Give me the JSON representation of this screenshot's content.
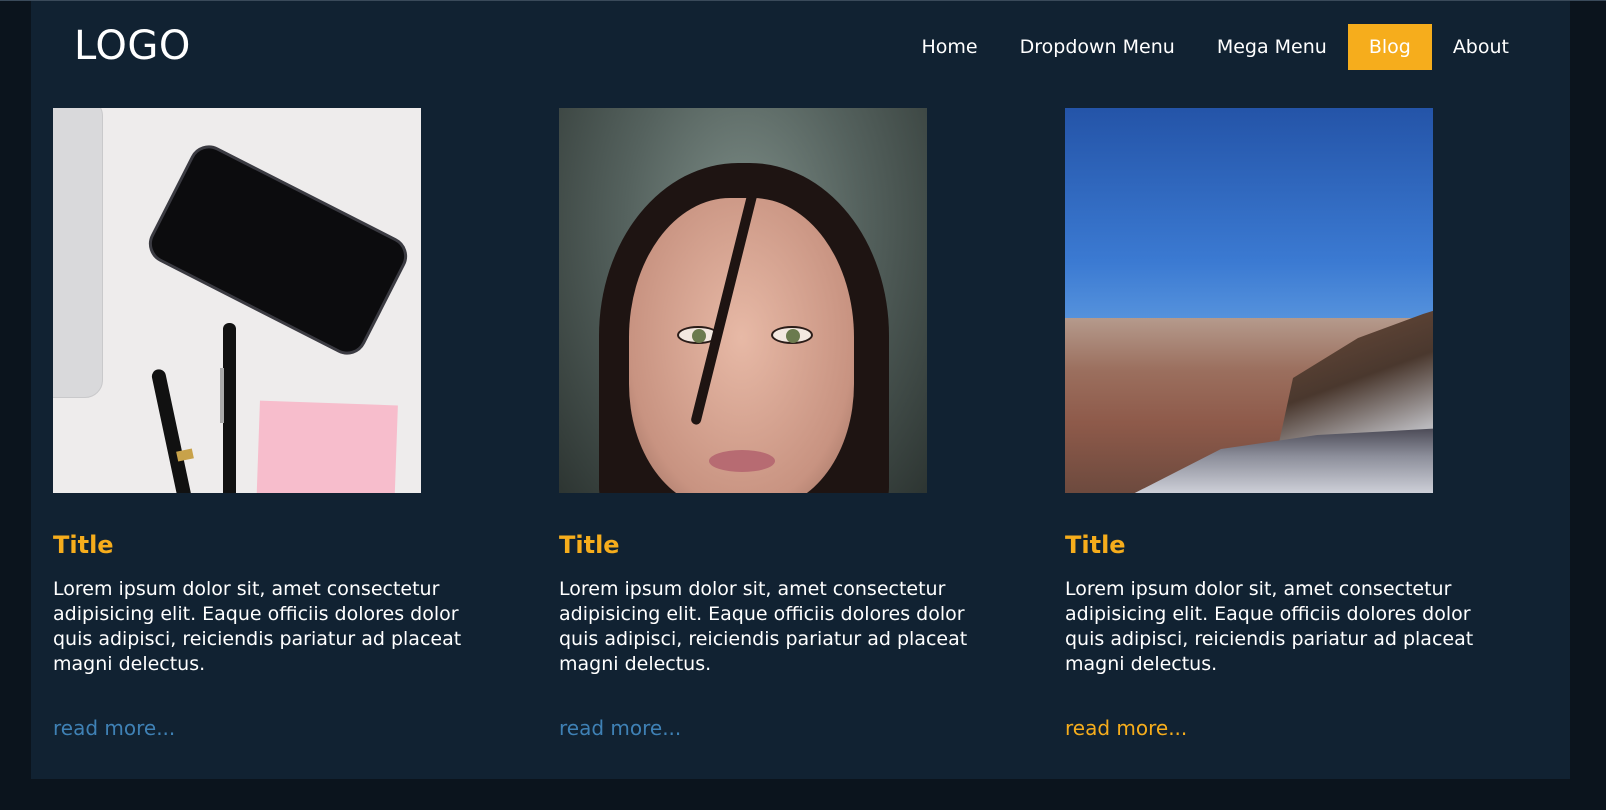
{
  "header": {
    "logo": "LOGO",
    "nav": [
      {
        "label": "Home",
        "active": false
      },
      {
        "label": "Dropdown Menu",
        "active": false
      },
      {
        "label": "Mega Menu",
        "active": false
      },
      {
        "label": "Blog",
        "active": true
      },
      {
        "label": "About",
        "active": false
      }
    ]
  },
  "colors": {
    "accent": "#f6ad1c",
    "link": "#3f81b5",
    "panel": "#112232",
    "background": "#0b141d"
  },
  "cards": [
    {
      "image": "desk-phone-pens-photo",
      "title": "Title",
      "text": "Lorem ipsum dolor sit, amet consectetur adipisicing elit. Eaque officiis dolores dolor quis adipisci, reiciendis pariatur ad placeat magni delectus.",
      "link": "read more..."
    },
    {
      "image": "woman-portrait-photo",
      "title": "Title",
      "text": "Lorem ipsum dolor sit, amet consectetur adipisicing elit. Eaque officiis dolores dolor quis adipisci, reiciendis pariatur ad placeat magni delectus.",
      "link": "read more..."
    },
    {
      "image": "canyon-landscape-photo",
      "title": "Title",
      "text": "Lorem ipsum dolor sit, amet consectetur adipisicing elit. Eaque officiis dolores dolor quis adipisci, reiciendis pariatur ad placeat magni delectus.",
      "link": "read more..."
    }
  ]
}
